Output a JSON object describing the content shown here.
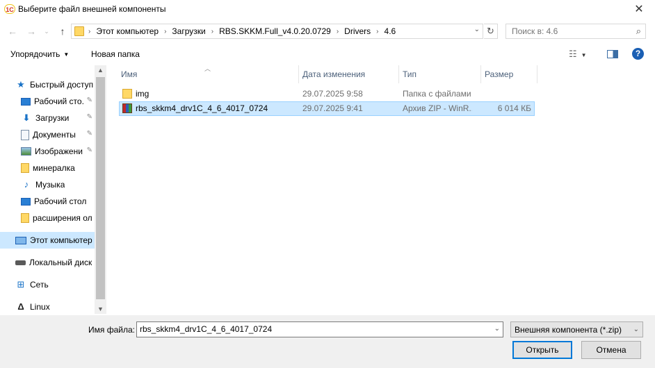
{
  "window": {
    "title": "Выберите файл внешней компоненты",
    "app_icon_text": "1С"
  },
  "address": {
    "crumbs": [
      "Этот компьютер",
      "Загрузки",
      "RBS.SKKM.Full_v4.0.20.0729",
      "Drivers",
      "4.6"
    ]
  },
  "search": {
    "placeholder": "Поиск в: 4.6"
  },
  "toolbar": {
    "organize_label": "Упорядочить",
    "new_folder_label": "Новая папка",
    "help_label": "?"
  },
  "nav": {
    "quick_access": "Быстрый доступ",
    "desktop_pinned": "Рабочий сто.",
    "downloads": "Загрузки",
    "documents": "Документы",
    "images": "Изображени",
    "mineral": "минералка",
    "music": "Музыка",
    "desktop": "Рабочий стол",
    "extensions": "расширения ол",
    "this_pc": "Этот компьютер",
    "local_disk": "Локальный диск",
    "network": "Сеть",
    "linux": "Linux"
  },
  "columns": {
    "name": "Имя",
    "date": "Дата изменения",
    "type": "Тип",
    "size": "Размер"
  },
  "files": [
    {
      "name": "img",
      "date": "29.07.2025 9:58",
      "type": "Папка с файлами",
      "size": ""
    },
    {
      "name": "rbs_skkm4_drv1C_4_6_4017_0724",
      "date": "29.07.2025 9:41",
      "type": "Архив ZIP - WinR...",
      "size": "6 014 КБ"
    }
  ],
  "bottom": {
    "filename_label": "Имя файла:",
    "filename_value": "rbs_skkm4_drv1C_4_6_4017_0724",
    "filter_label": "Внешняя компонента (*.zip)",
    "open_label": "Открыть",
    "cancel_label": "Отмена"
  },
  "colors": {
    "selection": "#cce8ff",
    "selection_border": "#99d1ff",
    "accent": "#0078d7",
    "header_text": "#4c607a"
  }
}
